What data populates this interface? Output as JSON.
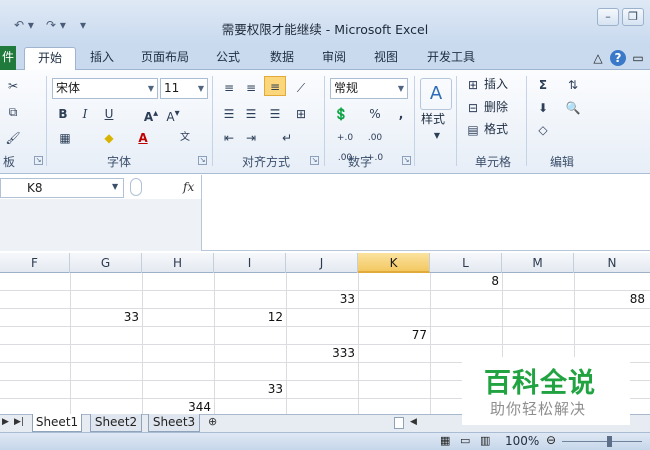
{
  "window": {
    "title": "需要权限才能继续 - Microsoft Excel"
  },
  "tabs": [
    {
      "label": "开始"
    },
    {
      "label": "插入"
    },
    {
      "label": "页面布局"
    },
    {
      "label": "公式"
    },
    {
      "label": "数据"
    },
    {
      "label": "审阅"
    },
    {
      "label": "视图"
    },
    {
      "label": "开发工具"
    }
  ],
  "ribbon": {
    "font_name": "宋体",
    "font_size": "11",
    "number_format": "常规",
    "groups": {
      "clipboard": "板",
      "font": "字体",
      "alignment": "对齐方式",
      "number": "数字",
      "styles": "样式",
      "cells": "单元格",
      "editing": "编辑"
    },
    "cells_buttons": {
      "insert": "插入",
      "delete": "删除",
      "format": "格式"
    },
    "percent": "%",
    "comma": ",",
    "dec_inc": "+.0 .00",
    "dec_dec": ".00 +.0"
  },
  "formula_bar": {
    "name_box": "K8",
    "fx": "fx",
    "content": ""
  },
  "columns": [
    "F",
    "G",
    "H",
    "I",
    "J",
    "K",
    "L",
    "M",
    "N"
  ],
  "selected_column": "K",
  "cells": [
    {
      "col": "L",
      "row": 0,
      "value": "8"
    },
    {
      "col": "J",
      "row": 1,
      "value": "33"
    },
    {
      "col": "N",
      "row": 1,
      "value": "88"
    },
    {
      "col": "G",
      "row": 2,
      "value": "33"
    },
    {
      "col": "I",
      "row": 2,
      "value": "12"
    },
    {
      "col": "K",
      "row": 3,
      "value": "77"
    },
    {
      "col": "J",
      "row": 4,
      "value": "333"
    },
    {
      "col": "I",
      "row": 6,
      "value": "33"
    },
    {
      "col": "H",
      "row": 7,
      "value": "344"
    }
  ],
  "sheets": [
    {
      "label": "Sheet1",
      "active": true
    },
    {
      "label": "Sheet2",
      "active": false
    },
    {
      "label": "Sheet3",
      "active": false
    }
  ],
  "status": {
    "zoom": "100%"
  },
  "watermark": {
    "title": "百科全说",
    "subtitle": "助你轻松解决"
  },
  "colors": {
    "accent_excel": "#1f7a3c",
    "selection": "#f3c861",
    "watermark_green": "#20a340"
  }
}
